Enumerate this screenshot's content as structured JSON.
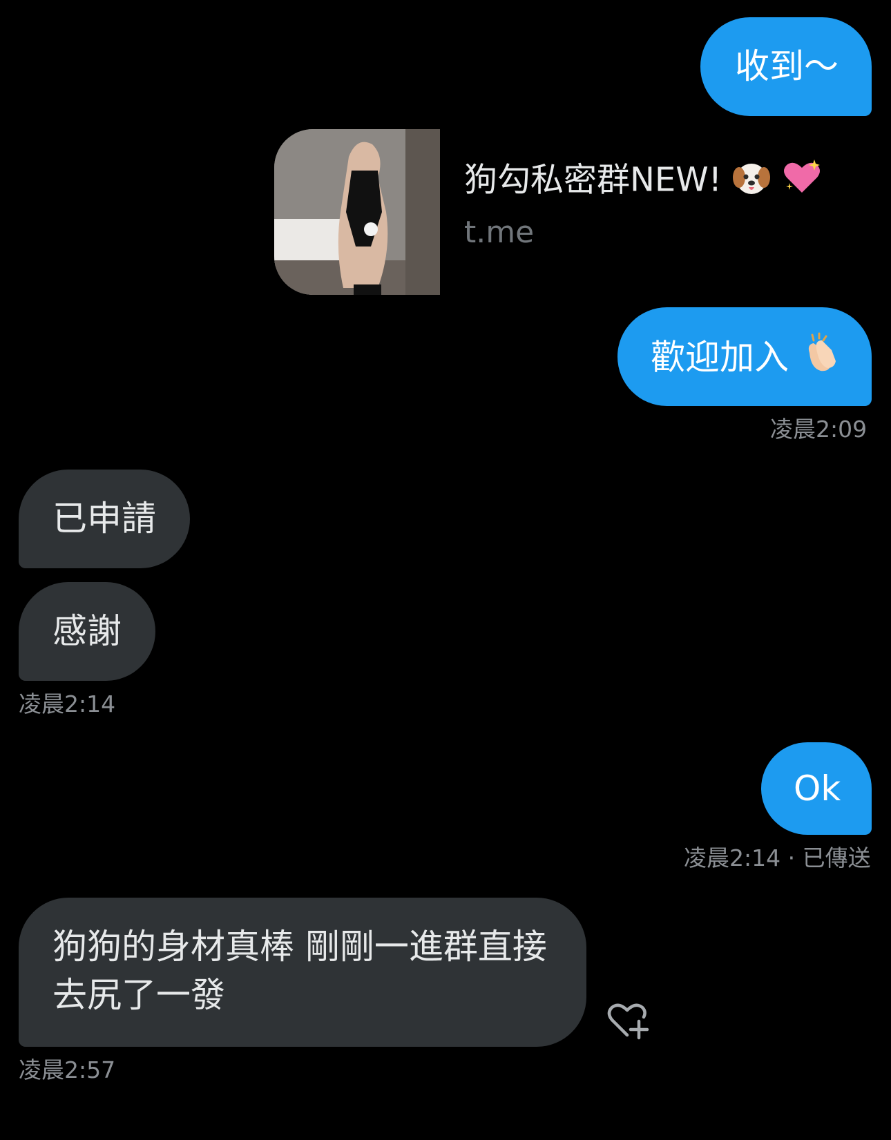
{
  "messages": {
    "m1": {
      "text": "收到～"
    },
    "link": {
      "title": "狗勾私密群NEW!",
      "domain": "t.me",
      "emoji_icons": [
        "dog-face-icon",
        "sparkling-heart-icon"
      ]
    },
    "m2": {
      "text": "歡迎加入"
    },
    "m2_time": "凌晨2:09",
    "m3": {
      "text": "已申請"
    },
    "m4": {
      "text": "感謝"
    },
    "m4_time": "凌晨2:14",
    "m5": {
      "text": "Ok"
    },
    "m5_status": "凌晨2:14 · 已傳送",
    "m6": {
      "line1": "狗狗的身材真棒 剛剛一進群直接",
      "line2": "去尻了一發"
    },
    "m6_time": "凌晨2:57"
  },
  "colors": {
    "sent_bubble": "#1d9bf0",
    "received_bubble": "#2f3336",
    "background": "#000000",
    "muted_text": "#8b8f94"
  },
  "icons": {
    "reaction": "heart-plus-icon",
    "clap": "clapping-hands-icon"
  }
}
